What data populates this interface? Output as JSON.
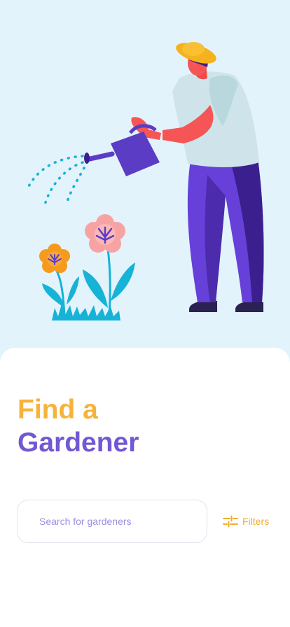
{
  "hero": {
    "illustration": "gardener-watering-flowers-illustration"
  },
  "heading": {
    "line1": "Find a",
    "line2": "Gardener"
  },
  "search": {
    "placeholder": "Search for gardeners",
    "value": ""
  },
  "filters": {
    "label": "Filters",
    "icon": "sliders-icon"
  },
  "colors": {
    "background": "#e3f3fc",
    "accent_orange": "#f6b23a",
    "accent_purple": "#7357d3",
    "placeholder": "#9a8fe0"
  }
}
